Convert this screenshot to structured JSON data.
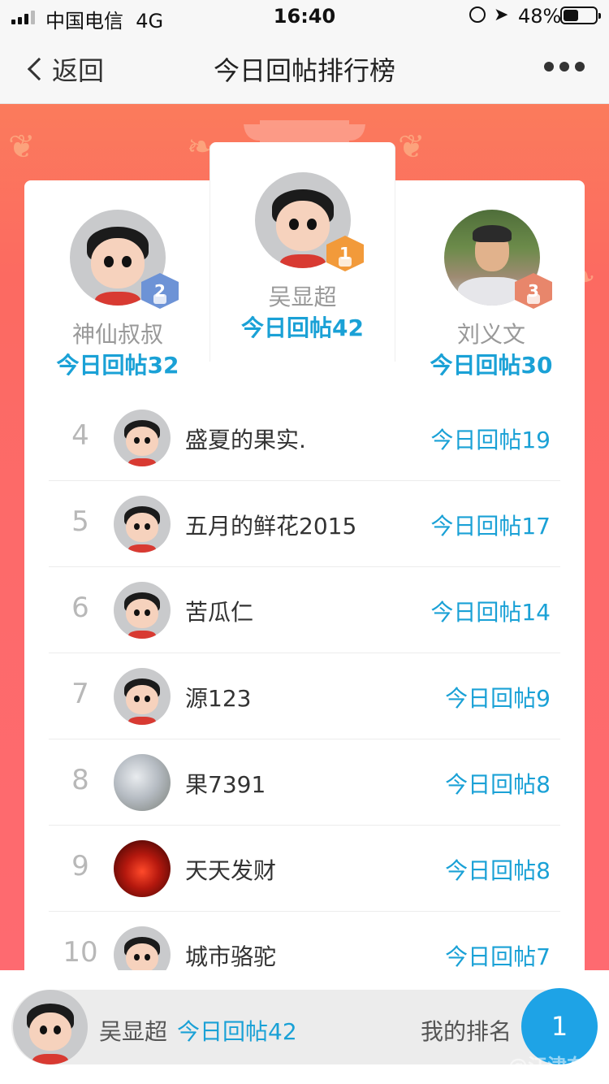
{
  "status_bar": {
    "carrier": "中国电信",
    "network": "4G",
    "time": "16:40",
    "battery": "48%",
    "battery_level": 0.48
  },
  "nav": {
    "back_label": "返回",
    "title": "今日回帖排行榜"
  },
  "podium": {
    "first": {
      "rank": "1",
      "name": "吴显超",
      "count": "今日回帖42",
      "medal_color": "#f29a3a"
    },
    "second": {
      "rank": "2",
      "name": "神仙叔叔",
      "count": "今日回帖32",
      "medal_color": "#6d93d6"
    },
    "third": {
      "rank": "3",
      "name": "刘义文",
      "count": "今日回帖30",
      "medal_color": "#e8866b"
    }
  },
  "list": [
    {
      "rank": "4",
      "name": "盛夏的果实.",
      "count": "今日回帖19",
      "avatar": "cartoon"
    },
    {
      "rank": "5",
      "name": "五月的鲜花2015",
      "count": "今日回帖17",
      "avatar": "cartoon"
    },
    {
      "rank": "6",
      "name": "苦瓜仁",
      "count": "今日回帖14",
      "avatar": "cartoon"
    },
    {
      "rank": "7",
      "name": "源123",
      "count": "今日回帖9",
      "avatar": "cartoon"
    },
    {
      "rank": "8",
      "name": "果7391",
      "count": "今日回帖8",
      "avatar": "blossom"
    },
    {
      "rank": "9",
      "name": "天天发财",
      "count": "今日回帖8",
      "avatar": "red"
    },
    {
      "rank": "10",
      "name": "城市骆驼",
      "count": "今日回帖7",
      "avatar": "cartoon"
    }
  ],
  "me": {
    "name": "吴显超",
    "count": "今日回帖42",
    "rank_label": "我的排名",
    "rank": "1"
  },
  "watermark": "@江津在线",
  "colors": {
    "accent_blue": "#1aa1d6",
    "banner_red": "#fd6a6a"
  }
}
